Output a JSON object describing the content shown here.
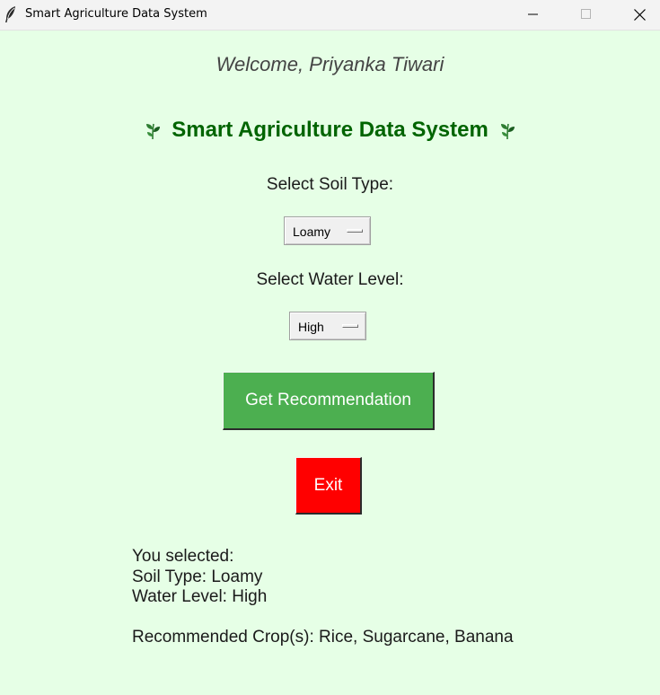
{
  "window": {
    "title": "Smart Agriculture Data System",
    "controls": [
      "minimize-icon",
      "maximize-icon",
      "close-icon"
    ]
  },
  "welcome": "Welcome, Priyanka Tiwari",
  "heading": {
    "text": "Smart Agriculture Data System",
    "icon": "leaf-icon",
    "color": "#006400"
  },
  "soil": {
    "label": "Select Soil Type:",
    "selected": "Loamy"
  },
  "water": {
    "label": "Select Water Level:",
    "selected": "High"
  },
  "buttons": {
    "recommend": "Get Recommendation",
    "recommend_color": "#4caf50",
    "exit": "Exit",
    "exit_color": "#ff0000"
  },
  "result": {
    "line1": "You selected:",
    "line2": "Soil Type: Loamy",
    "line3": "Water Level: High",
    "line4": "Recommended Crop(s): Rice, Sugarcane, Banana"
  },
  "colors": {
    "background": "#e6ffe6"
  }
}
